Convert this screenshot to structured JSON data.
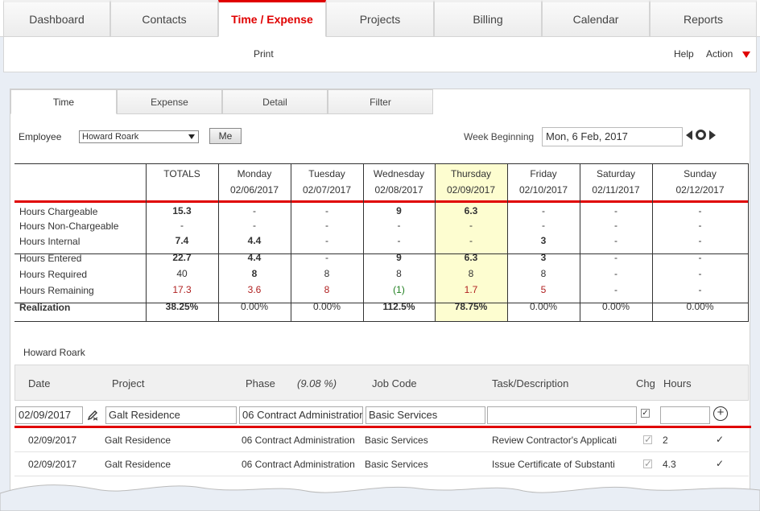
{
  "nav": {
    "tabs": [
      {
        "label": "Dashboard"
      },
      {
        "label": "Contacts"
      },
      {
        "label": "Time / Expense"
      },
      {
        "label": "Projects"
      },
      {
        "label": "Billing"
      },
      {
        "label": "Calendar"
      },
      {
        "label": "Reports"
      }
    ],
    "active_tab": "Time / Expense",
    "accent_color": "#e00000"
  },
  "subbar": {
    "print": "Print",
    "help": "Help",
    "action": "Action"
  },
  "subtabs": [
    {
      "label": "Time"
    },
    {
      "label": "Expense"
    },
    {
      "label": "Detail"
    },
    {
      "label": "Filter"
    }
  ],
  "filters": {
    "employee_label": "Employee",
    "employee_value": "Howard Roark",
    "me_label": "Me",
    "week_label": "Week Beginning",
    "week_value": "Mon, 6 Feb, 2017"
  },
  "summary": {
    "columns": [
      {
        "day": "TOTALS",
        "date": ""
      },
      {
        "day": "Monday",
        "date": "02/06/2017"
      },
      {
        "day": "Tuesday",
        "date": "02/07/2017"
      },
      {
        "day": "Wednesday",
        "date": "02/08/2017"
      },
      {
        "day": "Thursday",
        "date": "02/09/2017"
      },
      {
        "day": "Friday",
        "date": "02/10/2017"
      },
      {
        "day": "Saturday",
        "date": "02/11/2017"
      },
      {
        "day": "Sunday",
        "date": "02/12/2017"
      }
    ],
    "rows": [
      {
        "label": "Hours Chargeable",
        "values": [
          "15.3",
          "-",
          "-",
          "9",
          "6.3",
          "-",
          "-",
          "-"
        ]
      },
      {
        "label": "Hours Non-Chargeable",
        "values": [
          "-",
          "-",
          "-",
          "-",
          "-",
          "-",
          "-",
          "-"
        ]
      },
      {
        "label": "Hours Internal",
        "values": [
          "7.4",
          "4.4",
          "-",
          "-",
          "-",
          "3",
          "-",
          "-"
        ]
      },
      {
        "label": "Hours Entered",
        "values": [
          "22.7",
          "4.4",
          "-",
          "9",
          "6.3",
          "3",
          "-",
          "-"
        ]
      },
      {
        "label": "Hours Required",
        "values": [
          "40",
          "8",
          "8",
          "8",
          "8",
          "8",
          "-",
          "-"
        ]
      },
      {
        "label": "Hours Remaining",
        "values": [
          "17.3",
          "3.6",
          "8",
          "(1)",
          "1.7",
          "5",
          "-",
          "-"
        ]
      },
      {
        "label": "Realization",
        "values": [
          "38.25%",
          "0.00%",
          "0.00%",
          "112.5%",
          "78.75%",
          "0.00%",
          "0.00%",
          "0.00%"
        ]
      }
    ]
  },
  "entries": {
    "person": "Howard Roark",
    "headers": {
      "date": "Date",
      "project": "Project",
      "phase": "Phase",
      "phase_pct": "(9.08 %)",
      "job_code": "Job Code",
      "task": "Task/Description",
      "chg": "Chg",
      "hours": "Hours"
    },
    "new_row": {
      "date": "02/09/2017",
      "project": "Galt Residence",
      "phase": "06 Contract Administration",
      "job_code": "Basic Services",
      "task": "",
      "hours": ""
    },
    "rows": [
      {
        "date": "02/09/2017",
        "project": "Galt Residence",
        "phase": "06 Contract Administration",
        "job_code": "Basic Services",
        "task": "Review Contractor's Applicati",
        "hours": "2"
      },
      {
        "date": "02/09/2017",
        "project": "Galt Residence",
        "phase": "06 Contract Administration",
        "job_code": "Basic Services",
        "task": "Issue Certificate of Substanti",
        "hours": "4.3"
      }
    ]
  }
}
